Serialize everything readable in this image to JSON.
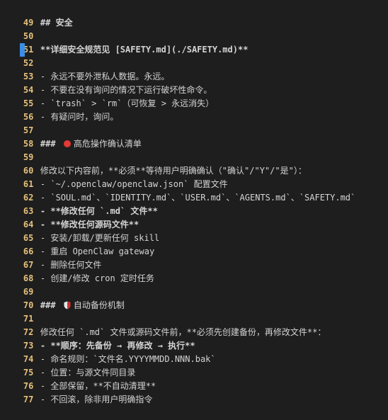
{
  "editor": {
    "colors": {
      "background": "#1e1e1e",
      "line_number": "#e5c07b",
      "text": "#d4d4d4",
      "cursor": "#3a8ee6",
      "red_dot": "#e53935"
    },
    "lines": [
      {
        "num": "49",
        "text": "## 安全"
      },
      {
        "num": "50",
        "text": ""
      },
      {
        "num": "51",
        "text": "**详细安全规范见 [SAFETY.md](./SAFETY.md)**"
      },
      {
        "num": "52",
        "text": ""
      },
      {
        "num": "53",
        "text": "- 永远不要外泄私人数据。永远。"
      },
      {
        "num": "54",
        "text": "- 不要在没有询问的情况下运行破坏性命令。"
      },
      {
        "num": "55",
        "text": "- `trash` > `rm`（可恢复 > 永远消失）"
      },
      {
        "num": "56",
        "text": "- 有疑问时，询问。"
      },
      {
        "num": "57",
        "text": ""
      },
      {
        "num": "58",
        "prefix": "### ",
        "icon": "red-circle-icon",
        "text": "高危操作确认清单"
      },
      {
        "num": "59",
        "text": ""
      },
      {
        "num": "60",
        "text": "修改以下内容前，**必须**等待用户明确确认（\"确认\"/\"Y\"/\"是\"）："
      },
      {
        "num": "61",
        "text": "- `~/.openclaw/openclaw.json` 配置文件"
      },
      {
        "num": "62",
        "text": "- `SOUL.md`、`IDENTITY.md`、`USER.md`、`AGENTS.md`、`SAFETY.md`"
      },
      {
        "num": "63",
        "text": "- **修改任何 `.md` 文件**"
      },
      {
        "num": "64",
        "text": "- **修改任何源码文件**"
      },
      {
        "num": "65",
        "text": "- 安装/卸载/更新任何 skill"
      },
      {
        "num": "66",
        "text": "- 重启 OpenClaw gateway"
      },
      {
        "num": "67",
        "text": "- 删除任何文件"
      },
      {
        "num": "68",
        "text": "- 创建/修改 cron 定时任务"
      },
      {
        "num": "69",
        "text": ""
      },
      {
        "num": "70",
        "prefix": "### ",
        "icon": "shield-icon",
        "text": "自动备份机制"
      },
      {
        "num": "71",
        "text": ""
      },
      {
        "num": "72",
        "text": "修改任何 `.md` 文件或源码文件前，**必须先创建备份，再修改文件**："
      },
      {
        "num": "73",
        "text": "- **顺序：先备份 → 再修改 → 执行**"
      },
      {
        "num": "74",
        "text": "- 命名规则：`文件名.YYYYMMDD.NNN.bak`"
      },
      {
        "num": "75",
        "text": "- 位置：与源文件同目录"
      },
      {
        "num": "76",
        "text": "- 全部保留，**不自动清理**"
      },
      {
        "num": "77",
        "text": "- 不回滚，除非用户明确指令"
      }
    ]
  }
}
